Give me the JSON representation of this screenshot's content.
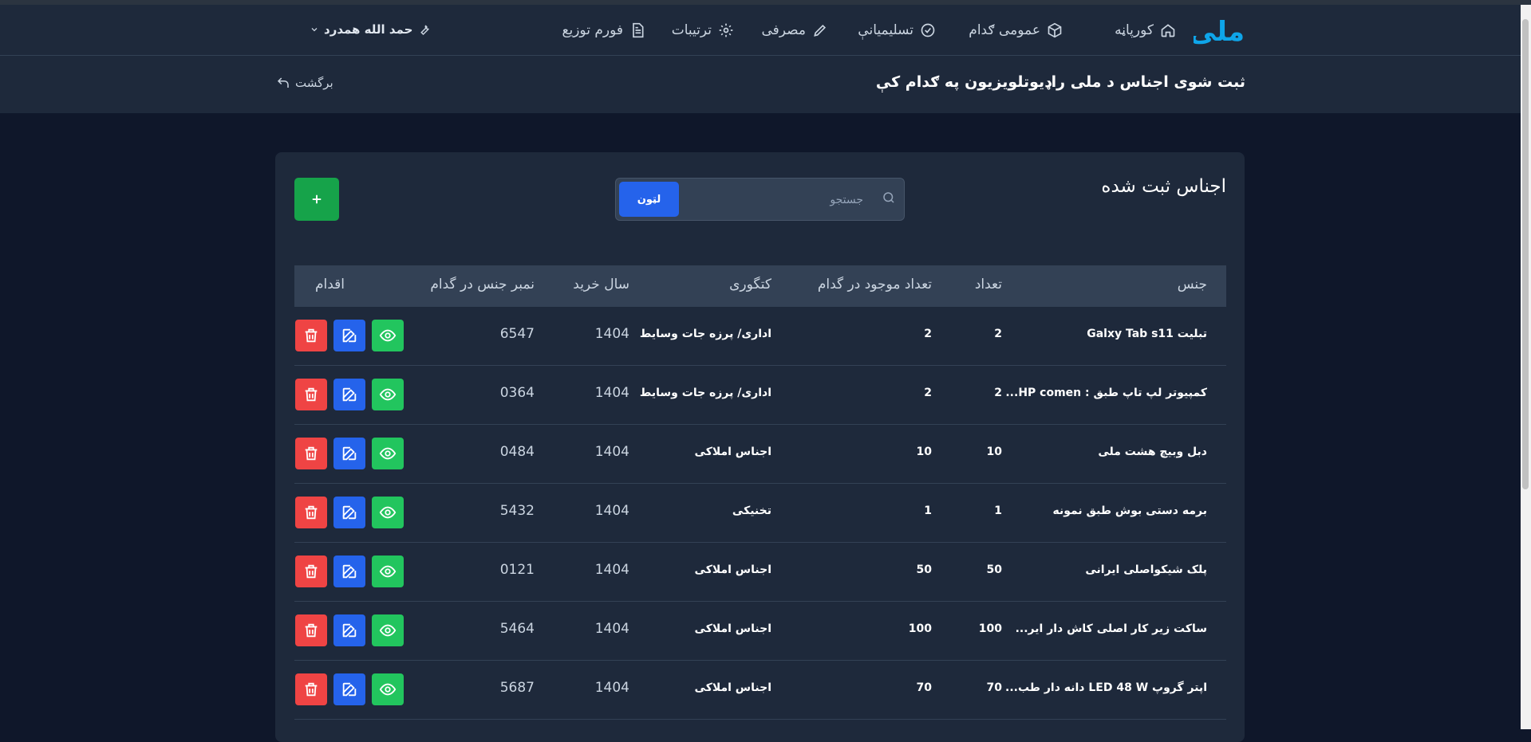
{
  "brand": {
    "logo_text": "ملی",
    "logo_color": "#0ea5e9"
  },
  "nav": {
    "items": [
      {
        "label": "کورپاڼه",
        "icon": "home-icon"
      },
      {
        "label": "عمومی ګدام",
        "icon": "box-icon"
      },
      {
        "label": "تسلیمیانې",
        "icon": "check-circle-icon"
      },
      {
        "label": "مصرفی",
        "icon": "pencil-icon"
      },
      {
        "label": "ترتیبات",
        "icon": "gear-icon"
      },
      {
        "label": "فورم توزیع",
        "icon": "document-icon"
      }
    ],
    "user": {
      "name": "حمد الله همدرد",
      "icon": "wrench-icon"
    }
  },
  "header": {
    "title": "ثبت شوی اجناس د ملی راډیوتلویزیون په ګدام کې",
    "back_label": "برگشت"
  },
  "card": {
    "title": "اجناس ثبت شده",
    "search": {
      "placeholder": "جستجو",
      "button_label": "لټون"
    },
    "add_label": "+"
  },
  "table": {
    "columns": [
      "جنس",
      "تعداد",
      "تعداد موجود در گدام",
      "کتگوری",
      "سال خرید",
      "نمبر جنس در گدام",
      "اقدام"
    ],
    "rows": [
      {
        "name": "تبلیت Galxy Tab s11",
        "qty": "2",
        "stock": "2",
        "category": "اداری/ پرزه جات وسایط",
        "year": "1404",
        "number": "6547"
      },
      {
        "name": "کمپیوتر لپ تاپ طبق : HP comen...",
        "qty": "2",
        "stock": "2",
        "category": "اداری/ پرزه جات وسایط",
        "year": "1404",
        "number": "0364"
      },
      {
        "name": "دبل وبیچ هشت ملی",
        "qty": "10",
        "stock": "10",
        "category": "اجناس املاکی",
        "year": "1404",
        "number": "0484"
      },
      {
        "name": "برمه دستی بوش طبق نمونه",
        "qty": "1",
        "stock": "1",
        "category": "تخنیکی",
        "year": "1404",
        "number": "5432"
      },
      {
        "name": "پلک شیکواصلی ایرانی",
        "qty": "50",
        "stock": "50",
        "category": "اجناس املاکی",
        "year": "1404",
        "number": "0121"
      },
      {
        "name": "ساکت زیر کار اصلی کاش دار ایر...",
        "qty": "100",
        "stock": "100",
        "category": "اجناس املاکی",
        "year": "1404",
        "number": "5464"
      },
      {
        "name": "اپتر گروپ LED 48 W دانه دار طب...",
        "qty": "70",
        "stock": "70",
        "category": "اجناس املاکی",
        "year": "1404",
        "number": "5687"
      }
    ]
  },
  "colors": {
    "delete": "#ef4444",
    "edit": "#2563eb",
    "view": "#22c55e",
    "add": "#16a34a"
  }
}
